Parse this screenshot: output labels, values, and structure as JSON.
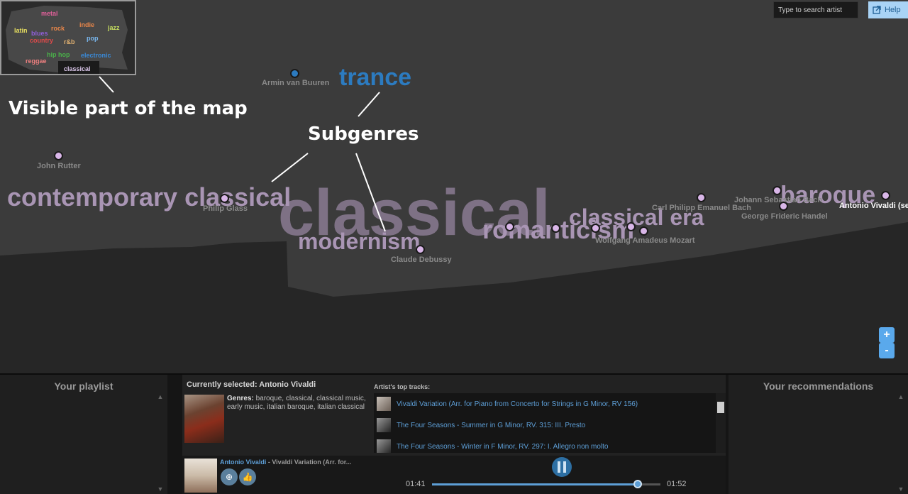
{
  "minimap": {
    "genres": [
      {
        "label": "metal",
        "color": "#e0609a"
      },
      {
        "label": "latin",
        "color": "#e8e060"
      },
      {
        "label": "blues",
        "color": "#8f5fd8"
      },
      {
        "label": "rock",
        "color": "#e8864a"
      },
      {
        "label": "indie",
        "color": "#e8864a"
      },
      {
        "label": "jazz",
        "color": "#c8e060"
      },
      {
        "label": "country",
        "color": "#e04a4a"
      },
      {
        "label": "r&b",
        "color": "#e0b070"
      },
      {
        "label": "pop",
        "color": "#7ab8f0"
      },
      {
        "label": "hip hop",
        "color": "#4ab04a"
      },
      {
        "label": "electronic",
        "color": "#3a8ad8"
      },
      {
        "label": "reggae",
        "color": "#f08080"
      },
      {
        "label": "classical",
        "color": "#dcc8ec"
      }
    ]
  },
  "annotations": {
    "visible_part": "Visible part of the map",
    "subgenres": "Subgenres"
  },
  "map": {
    "genres": {
      "trance": "trance",
      "contemporary": "contemporary classical",
      "classical": "classical",
      "modernism": "modernism",
      "romanticism": "romanticism",
      "classical_era": "classical era",
      "baroque": "baroque"
    },
    "artists": {
      "armin": "Armin van Buuren",
      "rutter": "John Rutter",
      "glass": "Philip Glass",
      "debussy": "Claude Debussy",
      "cpe_bach": "Carl Philipp Emanuel Bach",
      "js_bach": "Johann Sebastian Bach",
      "handel": "George Frideric Handel",
      "vivaldi": "Antonio Vivaldi (se",
      "mozart": "Wolfgang Amadeus Mozart"
    },
    "colors": {
      "classical": "#7e7185",
      "subgenre": "#a995b4",
      "trance": "#2c7bc0",
      "artist_dot": "#d9b6e8"
    }
  },
  "search": {
    "placeholder": "Type to search artist"
  },
  "help": {
    "label": "Help"
  },
  "zoom": {
    "in": "+",
    "out": "-"
  },
  "playlist": {
    "title": "Your playlist"
  },
  "recommendations": {
    "title": "Your recommendations"
  },
  "selected": {
    "title": "Currently selected: Antonio Vivaldi",
    "genres_label": "Genres:",
    "genres": " baroque, classical, classical music, early music, italian baroque, italian classical"
  },
  "tracks": {
    "title": "Artist's top tracks:",
    "items": [
      "Vivaldi Variation (Arr. for Piano from Concerto for Strings in G Minor, RV 156)",
      "The Four Seasons - Summer in G Minor, RV. 315: III. Presto",
      "The Four Seasons - Winter in F Minor, RV. 297: I. Allegro non molto"
    ]
  },
  "player": {
    "artist": "Antonio Vivaldi",
    "track": " - Vivaldi Variation (Arr. for...",
    "elapsed": "01:41",
    "duration": "01:52",
    "progress": 0.9
  }
}
